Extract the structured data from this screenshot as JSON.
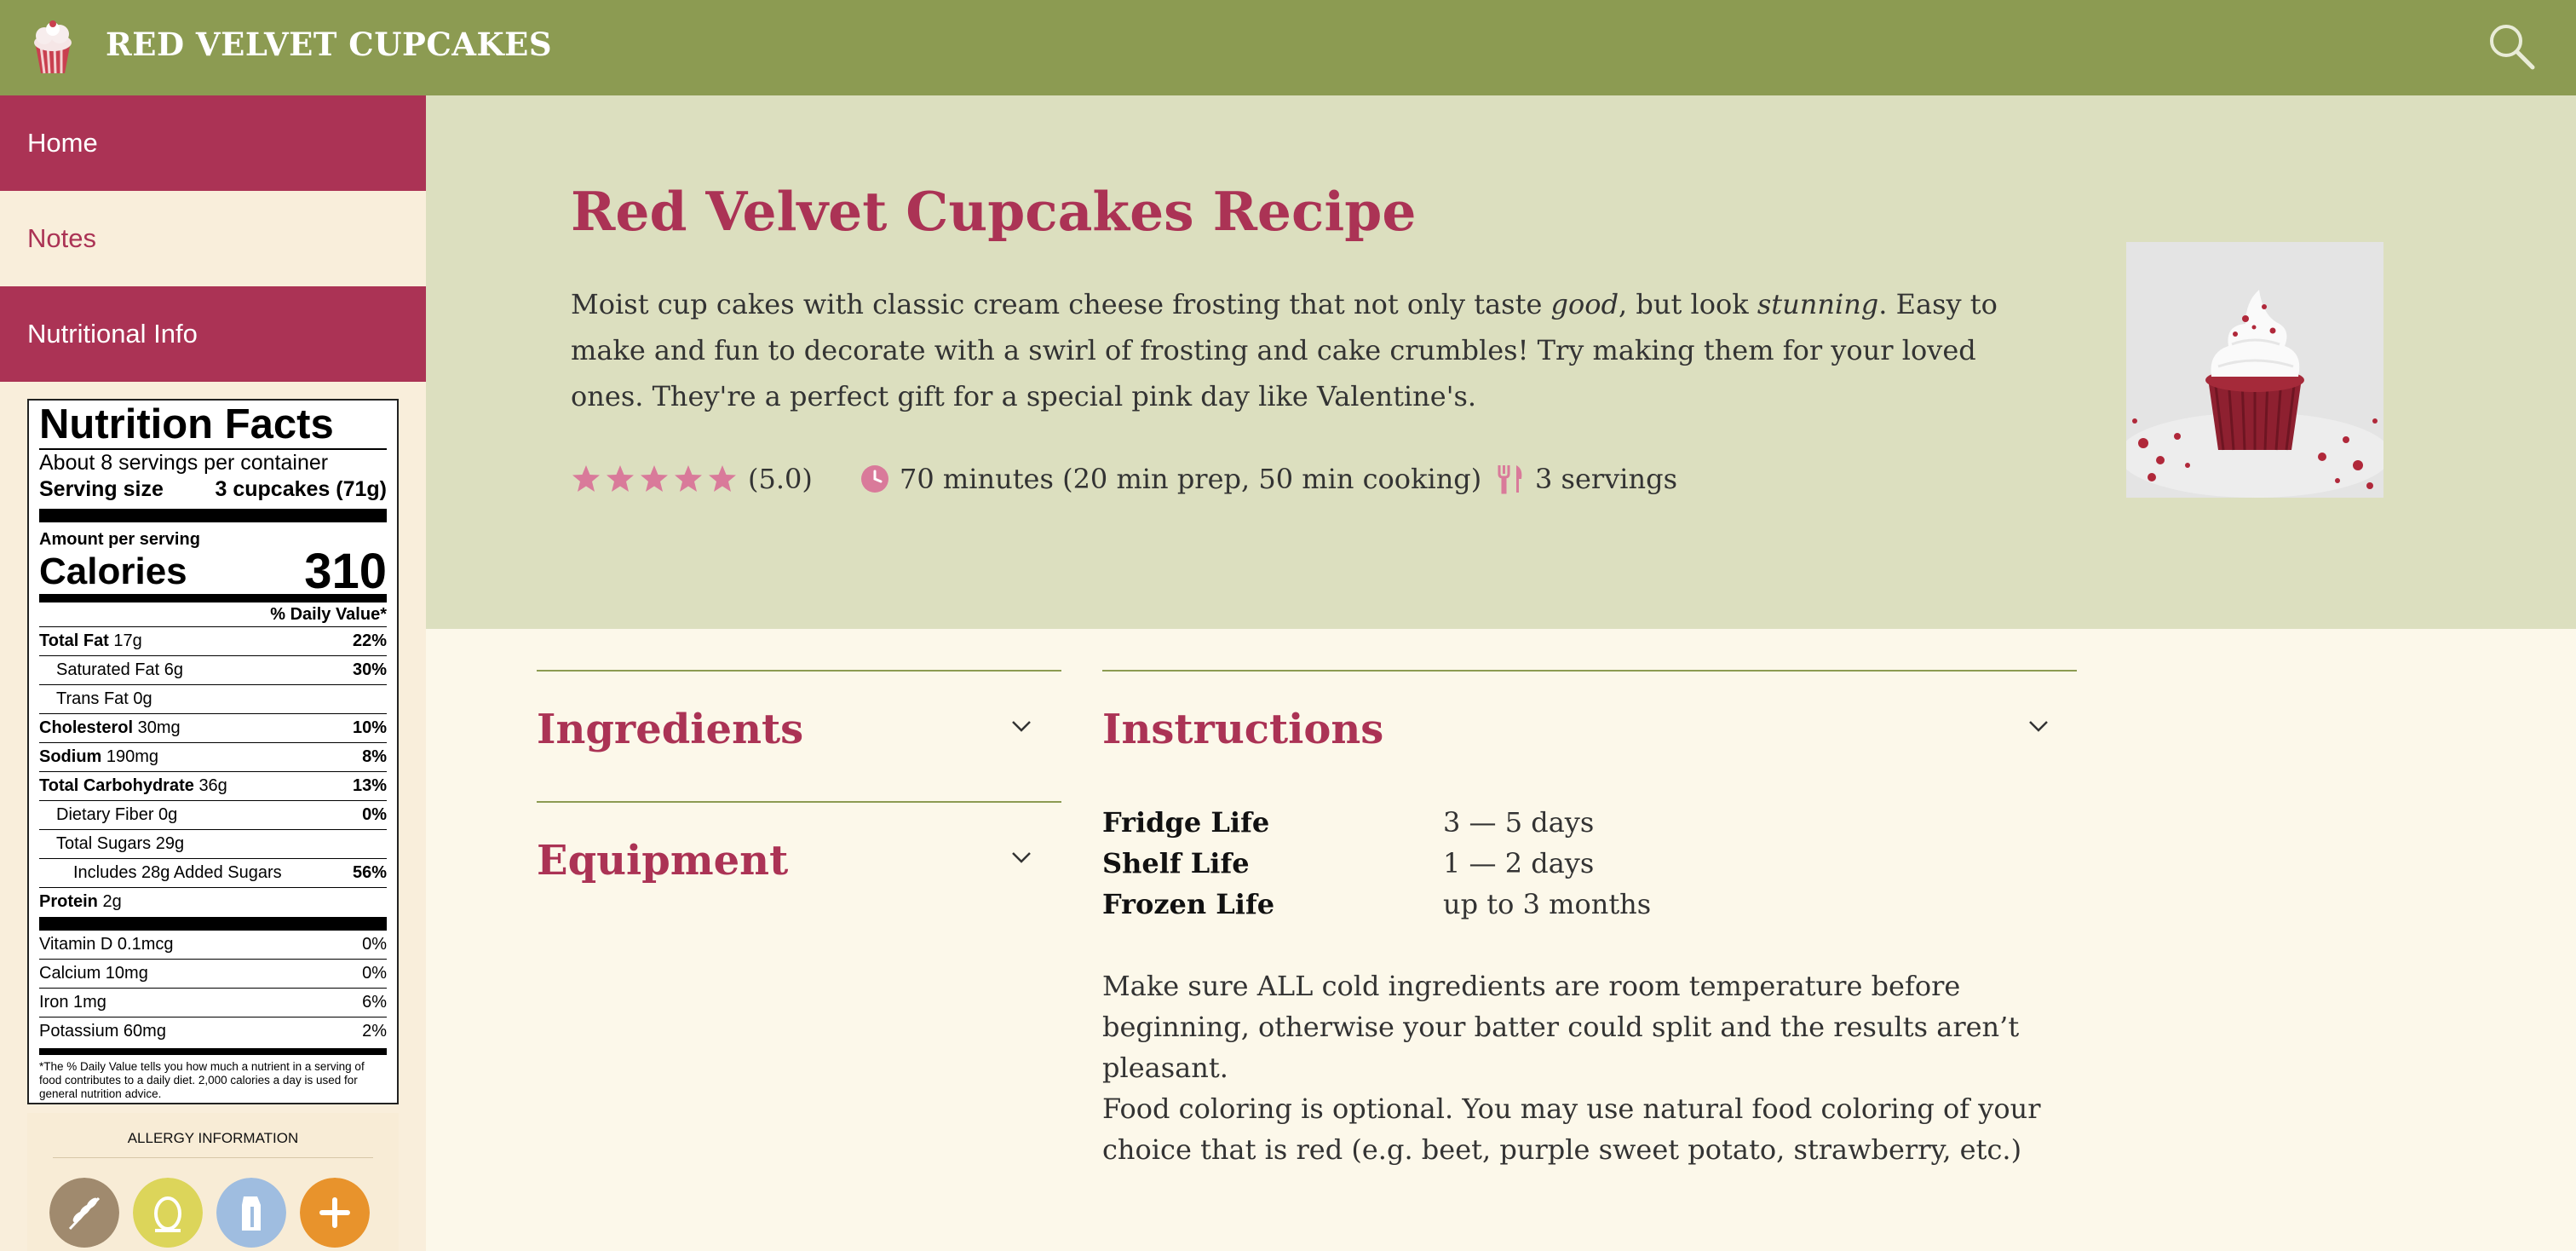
{
  "header": {
    "title": "RED VELVET CUPCAKES"
  },
  "sidebar": {
    "items": [
      {
        "label": "Home"
      },
      {
        "label": "Notes"
      },
      {
        "label": "Nutritional Info"
      }
    ]
  },
  "nutrition": {
    "title": "Nutrition Facts",
    "servings_per_container": "About 8 servings per container",
    "serving_size_label": "Serving size",
    "serving_size_value": "3 cupcakes (71g)",
    "amount_per_serving": "Amount per serving",
    "calories_label": "Calories",
    "calories_value": "310",
    "daily_value_header": "% Daily Value*",
    "rows": [
      {
        "name": "Total Fat",
        "amount": "17g",
        "dv": "22%"
      },
      {
        "name": "Saturated Fat",
        "amount": "6g",
        "dv": "30%"
      },
      {
        "name": "Trans Fat",
        "amount": "0g",
        "dv": ""
      },
      {
        "name": "Cholesterol",
        "amount": "30mg",
        "dv": "10%"
      },
      {
        "name": "Sodium",
        "amount": "190mg",
        "dv": "8%"
      },
      {
        "name": "Total Carbohydrate",
        "amount": "36g",
        "dv": "13%"
      },
      {
        "name": "Dietary Fiber",
        "amount": "0g",
        "dv": "0%"
      },
      {
        "name": "Total Sugars",
        "amount": "29g",
        "dv": ""
      },
      {
        "name": "Includes 28g Added Sugars",
        "amount": "",
        "dv": "56%"
      },
      {
        "name": "Protein",
        "amount": "2g",
        "dv": ""
      }
    ],
    "vitamins": [
      {
        "name": "Vitamin D 0.1mcg",
        "dv": "0%"
      },
      {
        "name": "Calcium 10mg",
        "dv": "0%"
      },
      {
        "name": "Iron 1mg",
        "dv": "6%"
      },
      {
        "name": "Potassium 60mg",
        "dv": "2%"
      }
    ],
    "footnote": "*The % Daily Value tells you how much a nutrient in a serving of food contributes to a daily diet. 2,000 calories a day is used for general nutrition advice."
  },
  "allergy": {
    "title": "ALLERGY INFORMATION",
    "icons": [
      "wheat-icon",
      "egg-icon",
      "milk-icon",
      "plus-icon"
    ],
    "colors": [
      "#a08a6e",
      "#dcd55a",
      "#9fbde0",
      "#e8932c"
    ]
  },
  "recipe": {
    "title": "Red Velvet Cupcakes Recipe",
    "desc_1": "Moist cup cakes with classic cream cheese frosting that not only taste ",
    "desc_good": "good",
    "desc_2": ", but look ",
    "desc_stunning": "stunning",
    "desc_3": ". Easy to make and fun to decorate with a swirl of frosting and cake crumbles! Try making them for your loved ones. They're a perfect gift for a special pink day like Valentine's.",
    "rating": 5.0,
    "rating_text": "(5.0)",
    "time_text": "70 minutes (20 min prep, 50 min cooking)",
    "servings_text": "3 servings",
    "star_color": "#d97a9a",
    "accent": "#ab3355"
  },
  "sections": {
    "ingredients": "Ingredients",
    "equipment": "Equipment",
    "instructions": "Instructions"
  },
  "storage": [
    {
      "label": "Fridge Life",
      "value": "3 — 5 days"
    },
    {
      "label": "Shelf Life",
      "value": "1 — 2 days"
    },
    {
      "label": "Frozen Life",
      "value": "up to 3 months"
    }
  ],
  "notes": [
    "Make sure ALL cold ingredients are room temperature before beginning, otherwise your batter could split and the results aren’t pleasant.",
    "Food coloring is optional. You may use natural food coloring of your choice that is red (e.g. beet, purple sweet potato, strawberry, etc.)"
  ]
}
